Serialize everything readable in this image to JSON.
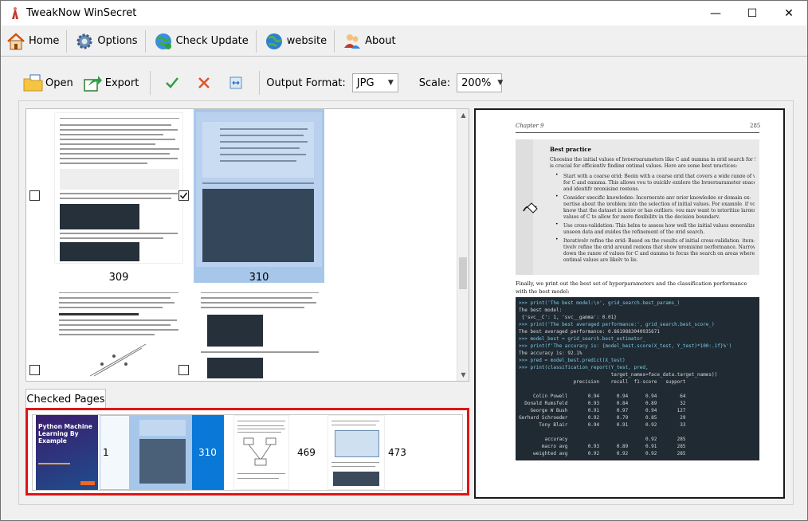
{
  "window": {
    "title": "TweakNow WinSecret",
    "minimize": "—",
    "maximize": "☐",
    "close": "✕"
  },
  "menu": {
    "home": "Home",
    "options": "Options",
    "check_update": "Check Update",
    "website": "website",
    "about": "About"
  },
  "toolbar": {
    "open": "Open",
    "export": "Export",
    "output_format_label": "Output Format:",
    "output_format_value": "JPG",
    "scale_label": "Scale:",
    "scale_value": "200%"
  },
  "pages": [
    {
      "number": "309",
      "checked": false
    },
    {
      "number": "310",
      "checked": true
    }
  ],
  "checked_pages": {
    "tab_label": "Checked Pages",
    "items": [
      {
        "number": "1",
        "cover_title": "Python Machine Learning By Example"
      },
      {
        "number": "310"
      },
      {
        "number": "469"
      },
      {
        "number": "473"
      }
    ]
  },
  "preview": {
    "chapter": "Chapter 9",
    "page_number": "285",
    "note_title": "Best practice",
    "note_lines": [
      "Choosing the initial values of hyperparameters like C and gamma in grid search for SVMs",
      "is crucial for efficiently finding optimal values. Here are some best practices:",
      "Start with a coarse grid: Begin with a coarse grid that covers a wide range of values",
      "for C and gamma. This allows you to quickly explore the hyperparameter space",
      "and identify promising regions.",
      "Consider specific knowledge: Incorporate any prior knowledge or domain ex-",
      "pertise about the problem into the selection of initial values. For example, if you",
      "know that the dataset is noisy or has outliers, you may want to prioritize larger",
      "values of C to allow for more flexibility in the decision boundary.",
      "Use cross-validation: This helps to assess how well the initial values generalize to",
      "unseen data and guides the refinement of the grid search.",
      "Iteratively refine the grid: Based on the results of initial cross-validation, itera-",
      "tively refine the grid around regions that show promising performance. Narrow",
      "down the range of values for C and gamma to focus the search on areas where the",
      "optimal values are likely to lie."
    ],
    "after_note": "Finally, we print out the best set of hyperparameters and the classification performance with the best model:",
    "code_lines": [
      ">>> print('The best model:\\n', grid_search.best_params_)",
      "The best model:",
      " {'svc__C': 1, 'svc__gamma': 0.01}",
      ">>> print('The best averaged performance:', grid_search.best_score_)",
      "The best averaged performance: 0.8619883040935671",
      ">>> model_best = grid_search.best_estimator_",
      ">>> print(f'The accuracy is: {model_best.score(X_test, Y_test)*100:.1f}%')",
      "The accuracy is: 92.1%",
      ">>> pred = model_best.predict(X_test)",
      ">>> print(classification_report(Y_test, pred,",
      "                                target_names=face_data.target_names))",
      "                   precision    recall  f1-score   support",
      "",
      "     Colin Powell       0.94      0.94      0.94        64",
      "  Donald Rumsfeld       0.93      0.84      0.89        32",
      "    George W Bush       0.91      0.97      0.94       127",
      "Gerhard Schroeder       0.92      0.79      0.85        29",
      "       Tony Blair       0.94      0.91      0.92        33",
      "",
      "         accuracy                           0.92       285",
      "        macro avg       0.93      0.89      0.91       285",
      "     weighted avg       0.92      0.92      0.92       285"
    ]
  },
  "colors": {
    "selection": "#a7c7ea",
    "checked_selected": "#0a78d7",
    "border_red": "#e01515"
  }
}
